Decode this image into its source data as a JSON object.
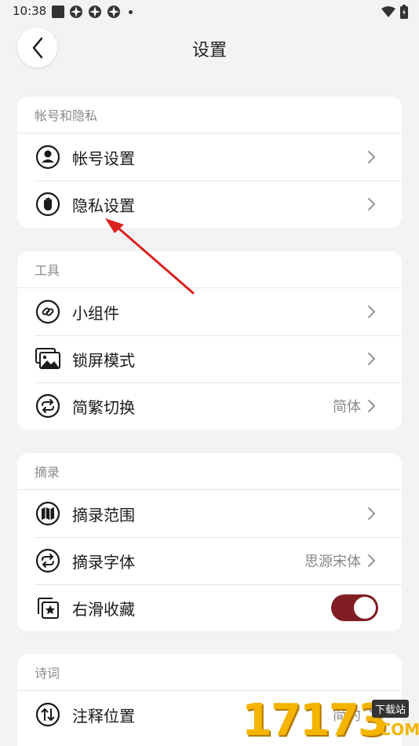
{
  "status_bar": {
    "time": "10:38"
  },
  "header": {
    "title": "设置"
  },
  "sections": {
    "account": {
      "title": "帐号和隐私",
      "items": [
        {
          "label": "帐号设置"
        },
        {
          "label": "隐私设置"
        }
      ]
    },
    "tools": {
      "title": "工具",
      "items": [
        {
          "label": "小组件"
        },
        {
          "label": "锁屏模式"
        },
        {
          "label": "简繁切换",
          "value": "简体"
        }
      ]
    },
    "excerpt": {
      "title": "摘录",
      "items": [
        {
          "label": "摘录范围"
        },
        {
          "label": "摘录字体",
          "value": "思源宋体"
        },
        {
          "label": "右滑收藏",
          "toggle_on": true
        }
      ]
    },
    "poetry": {
      "title": "诗词",
      "items": [
        {
          "label": "注释位置",
          "value": "简约"
        }
      ]
    }
  },
  "watermark": {
    "digits": "17173",
    "tag": "下载站",
    "domain": ".COM"
  },
  "colors": {
    "accent": "#7f1d22",
    "annotation_arrow": "#d9201e",
    "watermark": "#f4b400"
  }
}
